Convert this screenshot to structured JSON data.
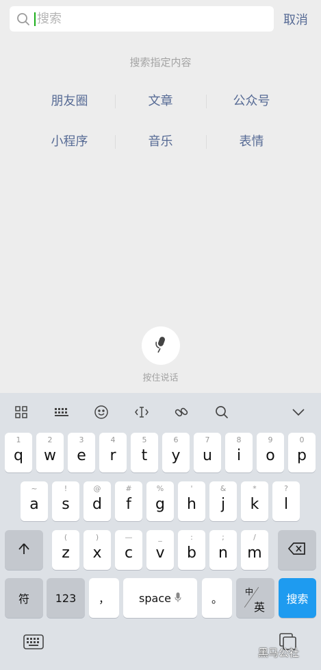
{
  "search": {
    "placeholder": "搜索",
    "cancel_label": "取消"
  },
  "hint_title": "搜索指定内容",
  "categories": [
    [
      "朋友圈",
      "文章",
      "公众号"
    ],
    [
      "小程序",
      "音乐",
      "表情"
    ]
  ],
  "voice": {
    "label": "按住说话",
    "icon": "microphone-icon"
  },
  "keyboard": {
    "row1": [
      {
        "k": "q",
        "n": "1"
      },
      {
        "k": "w",
        "n": "2"
      },
      {
        "k": "e",
        "n": "3"
      },
      {
        "k": "r",
        "n": "4"
      },
      {
        "k": "t",
        "n": "5"
      },
      {
        "k": "y",
        "n": "6"
      },
      {
        "k": "u",
        "n": "7"
      },
      {
        "k": "i",
        "n": "8"
      },
      {
        "k": "o",
        "n": "9"
      },
      {
        "k": "p",
        "n": "0"
      }
    ],
    "row2": [
      {
        "k": "a",
        "n": "~"
      },
      {
        "k": "s",
        "n": "!"
      },
      {
        "k": "d",
        "n": "@"
      },
      {
        "k": "f",
        "n": "#"
      },
      {
        "k": "g",
        "n": "%"
      },
      {
        "k": "h",
        "n": "'"
      },
      {
        "k": "j",
        "n": "&"
      },
      {
        "k": "k",
        "n": "*"
      },
      {
        "k": "l",
        "n": "?"
      }
    ],
    "row3": [
      {
        "k": "z",
        "n": "("
      },
      {
        "k": "x",
        "n": ")"
      },
      {
        "k": "c",
        "n": "—"
      },
      {
        "k": "v",
        "n": "_"
      },
      {
        "k": "b",
        "n": ":"
      },
      {
        "k": "n",
        "n": ";"
      },
      {
        "k": "m",
        "n": "/"
      }
    ],
    "sym_label": "符",
    "num_label": "123",
    "comma_label": "，",
    "space_label": "space",
    "period_label": "。",
    "lang_top": "中",
    "lang_bottom": "英",
    "search_key_label": "搜索"
  },
  "watermark": "黑马公社"
}
